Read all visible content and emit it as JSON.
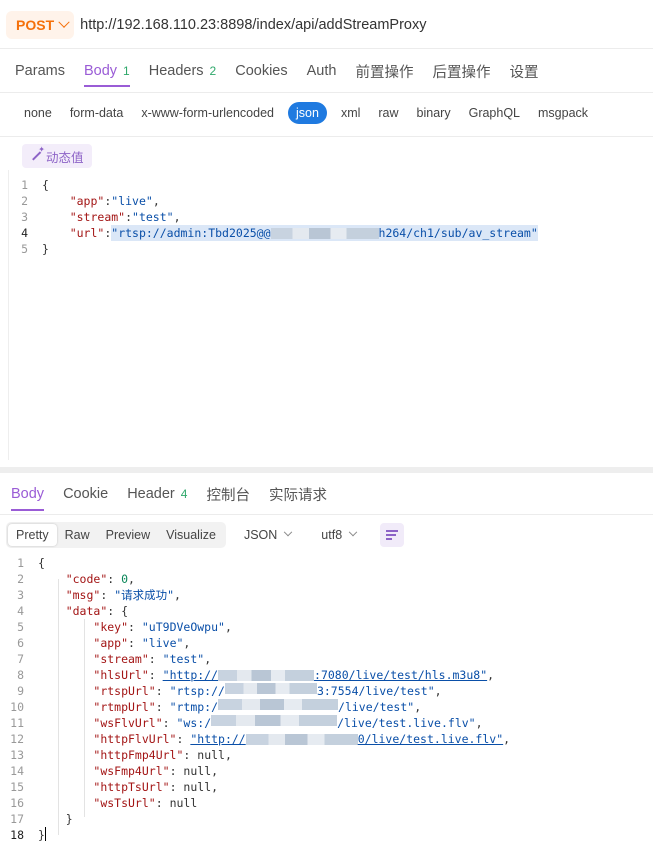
{
  "request": {
    "method": "POST",
    "url": "http://192.168.110.23:8898/index/api/addStreamProxy",
    "tabs": [
      {
        "label": "Params",
        "count": ""
      },
      {
        "label": "Body",
        "count": "1"
      },
      {
        "label": "Headers",
        "count": "2"
      },
      {
        "label": "Cookies",
        "count": ""
      },
      {
        "label": "Auth",
        "count": ""
      },
      {
        "label": "前置操作",
        "count": ""
      },
      {
        "label": "后置操作",
        "count": ""
      },
      {
        "label": "设置",
        "count": ""
      }
    ],
    "active_tab": "Body",
    "body_types": [
      "none",
      "form-data",
      "x-www-form-urlencoded",
      "json",
      "xml",
      "raw",
      "binary",
      "GraphQL",
      "msgpack"
    ],
    "selected_body_type": "json",
    "dynamic_value_label": "动态值",
    "body_lines": {
      "l1": "{",
      "l2_key": "\"app\"",
      "l2_val": "\"live\"",
      "l3_key": "\"stream\"",
      "l3_val": "\"test\"",
      "l4_key": "\"url\"",
      "l4_val_a": "\"rtsp://admin:Tbd2025@@",
      "l4_val_b": "h264/ch1/sub/av_stream\"",
      "l5": "}"
    }
  },
  "response": {
    "tabs": [
      {
        "label": "Body",
        "count": ""
      },
      {
        "label": "Cookie",
        "count": ""
      },
      {
        "label": "Header",
        "count": "4"
      },
      {
        "label": "控制台",
        "count": ""
      },
      {
        "label": "实际请求",
        "count": ""
      }
    ],
    "view_modes": [
      "Pretty",
      "Raw",
      "Preview",
      "Visualize"
    ],
    "selected_view": "Pretty",
    "format": "JSON",
    "encoding": "utf8",
    "body": {
      "code_key": "\"code\"",
      "code_val": "0",
      "msg_key": "\"msg\"",
      "msg_val": "\"请求成功\"",
      "data_key": "\"data\"",
      "key_key": "\"key\"",
      "key_val": "\"uT9DVeOwpu\"",
      "app_key": "\"app\"",
      "app_val": "\"live\"",
      "stream_key": "\"stream\"",
      "stream_val": "\"test\"",
      "hls_key": "\"hlsUrl\"",
      "hls_a": "\"http://",
      "hls_b": ":7080/live/test/hls.m3u8\"",
      "rtsp_key": "\"rtspUrl\"",
      "rtsp_a": "\"rtsp://",
      "rtsp_b": "3:7554/live/test\"",
      "rtmp_key": "\"rtmpUrl\"",
      "rtmp_a": "\"rtmp:/",
      "rtmp_b": "/live/test\"",
      "wsflv_key": "\"wsFlvUrl\"",
      "wsflv_a": "\"ws:/",
      "wsflv_b": "/live/test.live.flv\"",
      "httpflv_key": "\"httpFlvUrl\"",
      "httpflv_a": "\"http://",
      "httpflv_b": "0/live/test.live.flv\"",
      "httpfmp4_key": "\"httpFmp4Url\"",
      "wsfmp4_key": "\"wsFmp4Url\"",
      "httpts_key": "\"httpTsUrl\"",
      "wsts_key": "\"wsTsUrl\"",
      "null_val": "null"
    }
  },
  "colors": {
    "accent": "#9a5cd6",
    "method": "#f5700a",
    "selected_pill": "#1f7ae0",
    "count_badge": "#2fa86b"
  }
}
